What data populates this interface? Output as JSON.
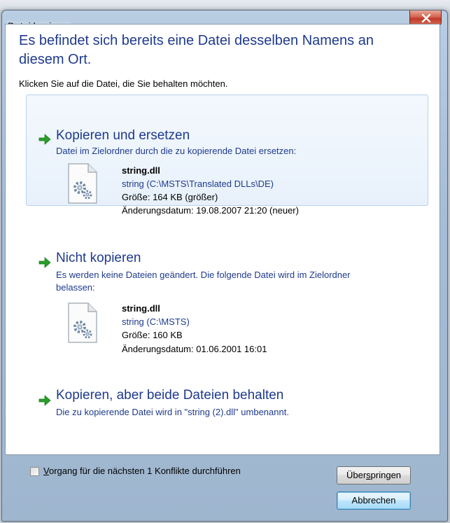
{
  "window": {
    "title": "Datei kopieren"
  },
  "heading": "Es befindet sich bereits eine Datei desselben Namens an diesem Ort.",
  "subheading": "Klicken Sie auf die Datei, die Sie behalten möchten.",
  "options": [
    {
      "title": "Kopieren und ersetzen",
      "description": "Datei im Zielordner durch die zu kopierende Datei ersetzen:",
      "file": {
        "name": "string.dll",
        "path": "string (C:\\MSTS\\Translated DLLs\\DE)",
        "size": "Größe: 164 KB (größer)",
        "modified": "Änderungsdatum: 19.08.2007 21:20 (neuer)"
      }
    },
    {
      "title": "Nicht kopieren",
      "description_line1": "Es werden keine Dateien geändert. Die folgende Datei wird im Zielordner",
      "description_line2": "belassen:",
      "file": {
        "name": "string.dll",
        "path": "string (C:\\MSTS)",
        "size": "Größe: 160 KB",
        "modified": "Änderungsdatum: 01.06.2001 16:01"
      }
    },
    {
      "title": "Kopieren, aber beide Dateien behalten",
      "description": "Die zu kopierende Datei wird in \"string (2).dll\" umbenannt."
    }
  ],
  "footer": {
    "checkbox_accel": "V",
    "checkbox_label_rest": "organg für die nächsten 1 Konflikte durchführen",
    "checkbox_checked": false,
    "skip_pre": "Über",
    "skip_accel": "s",
    "skip_post": "pringen",
    "cancel_label": "Abbrechen"
  },
  "colors": {
    "link_blue": "#1e3a8c",
    "arrow_green": "#2a9d2a",
    "close_red": "#c0392b"
  }
}
